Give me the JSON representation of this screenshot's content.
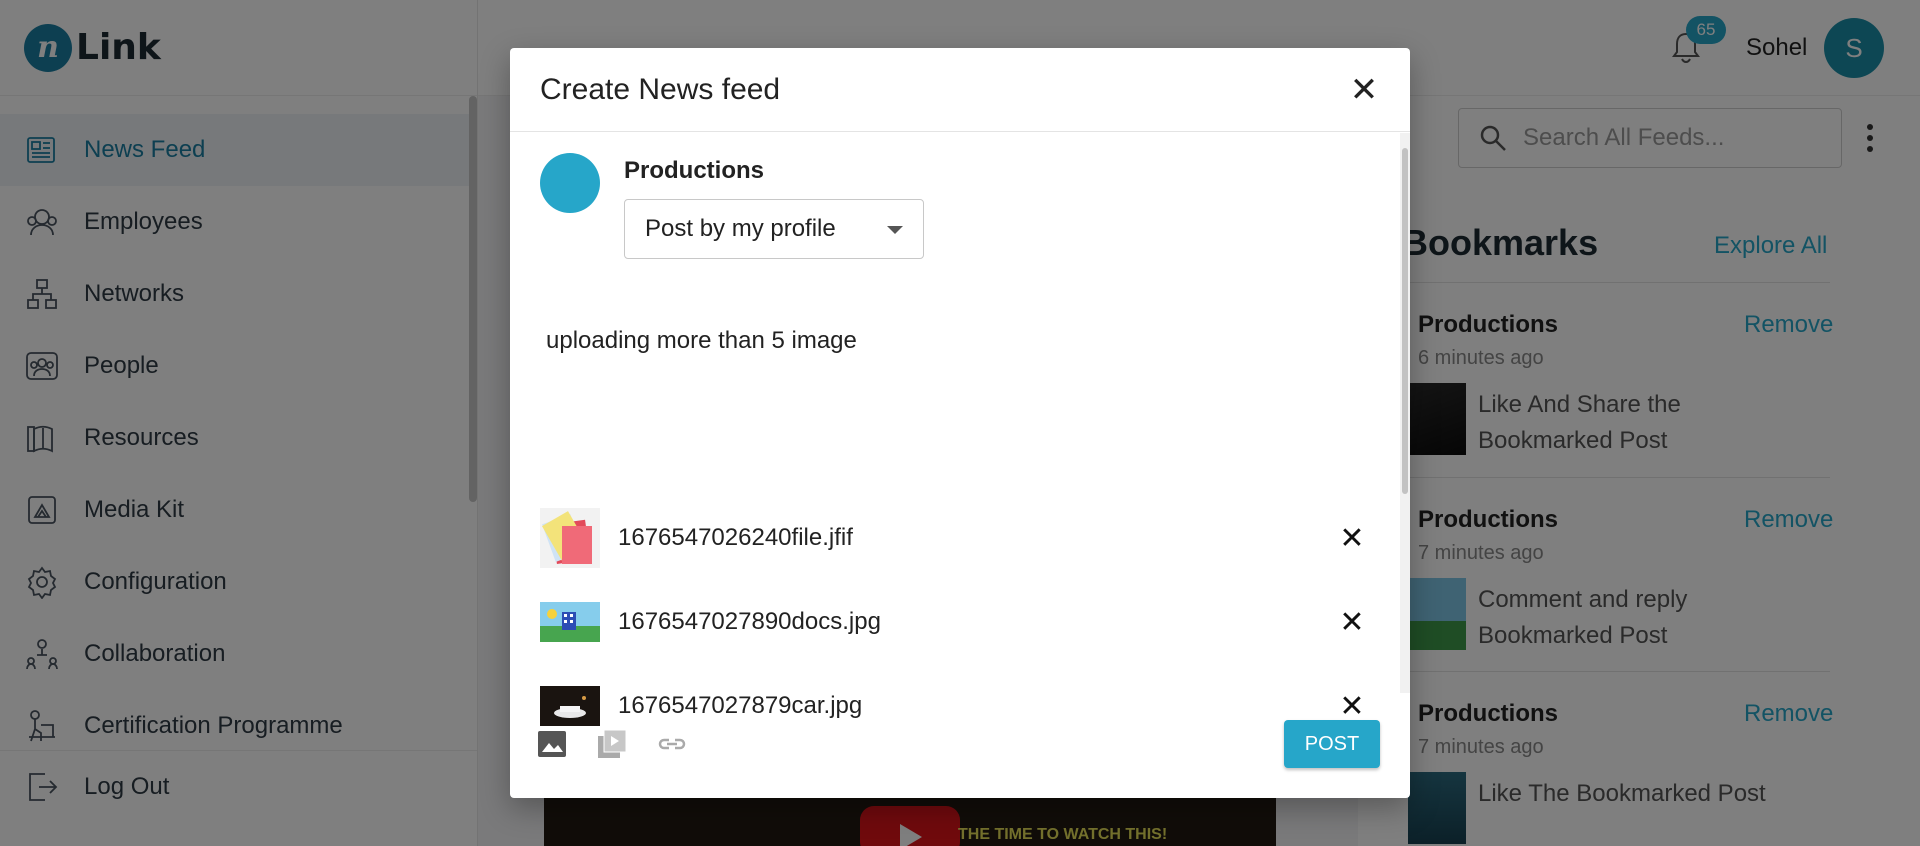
{
  "app": {
    "logo_mark": "n",
    "logo_text": "Link"
  },
  "sidebar": {
    "items": [
      {
        "label": "News Feed",
        "icon": "newspaper-icon",
        "active": true
      },
      {
        "label": "Employees",
        "icon": "employees-icon"
      },
      {
        "label": "Networks",
        "icon": "network-icon"
      },
      {
        "label": "People",
        "icon": "people-icon"
      },
      {
        "label": "Resources",
        "icon": "book-icon"
      },
      {
        "label": "Media Kit",
        "icon": "media-kit-icon"
      },
      {
        "label": "Configuration",
        "icon": "gear-icon"
      },
      {
        "label": "Collaboration",
        "icon": "collaboration-icon"
      },
      {
        "label": "Certification Programme",
        "icon": "certification-icon"
      }
    ],
    "logout_label": "Log Out"
  },
  "header": {
    "notification_count": "65",
    "user_name": "Sohel",
    "avatar_initial": "S"
  },
  "search": {
    "placeholder": "Search All Feeds..."
  },
  "bookmarks": {
    "title": "Bookmarks",
    "explore_label": "Explore All",
    "items": [
      {
        "name": "Productions",
        "remove_label": "Remove",
        "time": "6 minutes ago",
        "text": "Like And Share the Bookmarked Post"
      },
      {
        "name": "Productions",
        "remove_label": "Remove",
        "time": "7 minutes ago",
        "text": "Comment and reply Bookmarked Post"
      },
      {
        "name": "Productions",
        "remove_label": "Remove",
        "time": "7 minutes ago",
        "text": "Like The Bookmarked Post"
      }
    ]
  },
  "feed": {
    "video_caption": "THE TIME TO WATCH THIS!"
  },
  "modal": {
    "title": "Create News feed",
    "close_icon": "close-icon",
    "poster_name": "Productions",
    "post_as": "Post by my profile",
    "post_text": "uploading more than 5 image",
    "files": [
      {
        "name": "1676547026240file.jfif"
      },
      {
        "name": "1676547027890docs.jpg"
      },
      {
        "name": "1676547027879car.jpg"
      }
    ],
    "post_button": "POST"
  },
  "colors": {
    "accent": "#26a6c9",
    "brand": "#1b7fa3"
  }
}
